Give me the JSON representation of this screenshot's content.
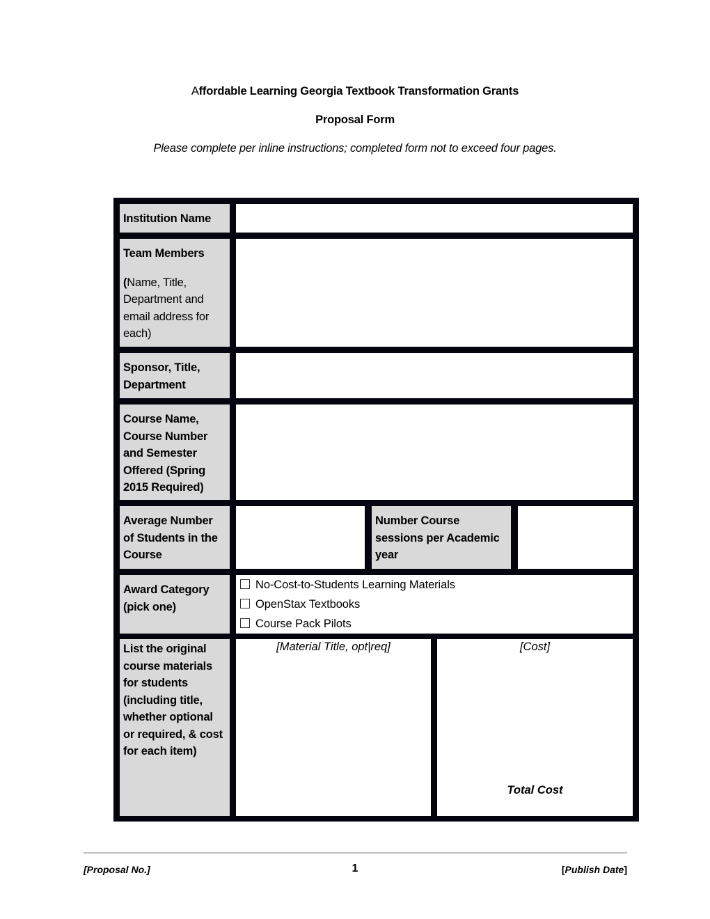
{
  "header": {
    "title_first_letter": "A",
    "title_rest": "ffordable Learning Georgia Textbook Transformation Grants",
    "subtitle": "Proposal Form",
    "instructions": "Please complete per inline instructions; completed form not to exceed four pages."
  },
  "form": {
    "institution_name": {
      "label": "Institution Name",
      "value": ""
    },
    "team_members": {
      "label": "Team Members",
      "hint_open_paren": "(",
      "hint": "Name, Title, Department and email address for each)",
      "value": ""
    },
    "sponsor": {
      "label": "Sponsor, Title, Department",
      "value": ""
    },
    "course": {
      "label": "Course Name, Course Number and Semester Offered (Spring 2015 Required)",
      "value": ""
    },
    "avg_students": {
      "label": "Average Number of Students in the Course",
      "value": ""
    },
    "sessions_per_year": {
      "label": "Number Course sessions per Academic year",
      "value": ""
    },
    "award_category": {
      "label": "Award Category (pick one)",
      "options": [
        {
          "label": "No-Cost-to-Students Learning Materials",
          "checked": false
        },
        {
          "label": "OpenStax Textbooks",
          "checked": false
        },
        {
          "label": "Course Pack Pilots",
          "checked": false
        }
      ]
    },
    "materials": {
      "label": "List the original course materials for students (including title, whether optional or required, & cost for each item)",
      "title_column_header": "[Material Title, opt|req]",
      "cost_column_header": "[Cost]",
      "total_label": "Total Cost"
    }
  },
  "footer": {
    "proposal_no": "[Proposal No.]",
    "page_number": "1",
    "publish_date_open": "[",
    "publish_date": "Publish Date",
    "publish_date_close": "]"
  }
}
